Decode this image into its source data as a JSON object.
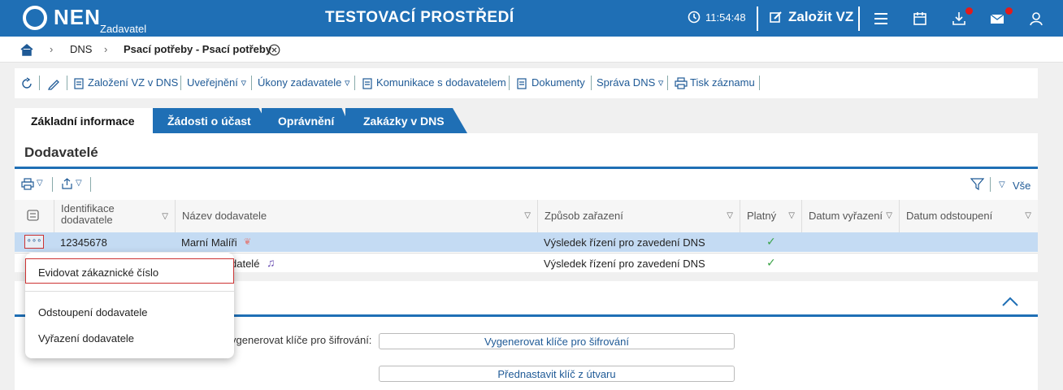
{
  "header": {
    "logo_text": "NEN",
    "logo_sub": "Zadavatel",
    "environment": "TESTOVACÍ PROSTŘEDÍ",
    "clock": "11:54:48",
    "create_label": "Založit VZ",
    "accent": "#1f6fb5",
    "notification_color": "#e21b1b"
  },
  "breadcrumb": {
    "items": [
      "DNS",
      "Psací potřeby - Psací potřeby"
    ]
  },
  "toolbar": {
    "items": [
      "Založení VZ v DNS",
      "Uveřejnění ▿",
      "Úkony zadavatele ▿",
      "Komunikace s dodavatelem",
      "Dokumenty",
      "Správa DNS ▿",
      "Tisk záznamu"
    ]
  },
  "tabs": [
    "Základní informace",
    "Žádosti o účast",
    "Oprávnění",
    "Zakázky v DNS"
  ],
  "panel": {
    "title": "Dodavatelé",
    "filter_all": "Vše",
    "columns": [
      "Identifikace dodavatele",
      "Název dodavatele",
      "Způsob zařazení",
      "Platný",
      "Datum vyřazení",
      "Datum odstoupení"
    ],
    "rows": [
      {
        "id": "12345678",
        "name": "Marní Malíři",
        "method": "Výsledek řízení pro zavedení DNS"
      },
      {
        "id": "",
        "name": "datelé",
        "method": "Výsledek řízení pro zavedení DNS"
      }
    ]
  },
  "panel2": {
    "label": "ygenerovat klíče pro šifrování:",
    "btn_generate": "Vygenerovat klíče pro šifrování",
    "btn_preset": "Přednastavit klíč z útvaru"
  },
  "context_menu": {
    "items": [
      "Evidovat zákaznické číslo",
      "Odstoupení dodavatele",
      "Vyřazení dodavatele"
    ]
  }
}
